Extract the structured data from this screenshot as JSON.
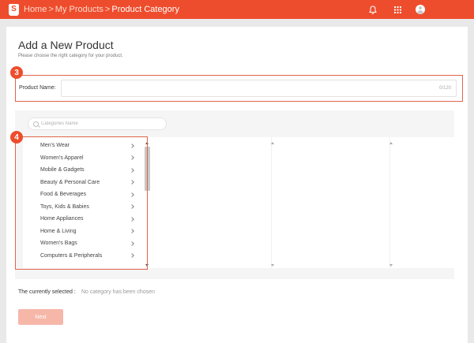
{
  "header": {
    "logo_glyph": "S",
    "breadcrumb": [
      "Home",
      "My Products",
      "Product Category"
    ],
    "separator": ">",
    "accent_color": "#ee4d2d"
  },
  "page": {
    "title": "Add a New Product",
    "subtitle": "Please choose the right category for your product."
  },
  "annotations": {
    "badge_3": "3",
    "badge_4": "4"
  },
  "product_name": {
    "label": "Product Name:",
    "value": "",
    "counter": "0/120"
  },
  "categories": {
    "search_placeholder": "Categories Name",
    "level1": [
      "Men's Wear",
      "Women's Apparel",
      "Mobile & Gadgets",
      "Beauty & Personal Care",
      "Food & Beverages",
      "Toys, Kids & Babies",
      "Home Appliances",
      "Home & Living",
      "Women's Bags",
      "Computers & Peripherals"
    ]
  },
  "selection": {
    "label": "The currently selected :",
    "value": "No category has been chosen"
  },
  "next_button": "Next",
  "icons": {
    "notifications": "bell-icon",
    "apps": "grid-icon",
    "user": "avatar-icon",
    "search": "search-icon"
  }
}
